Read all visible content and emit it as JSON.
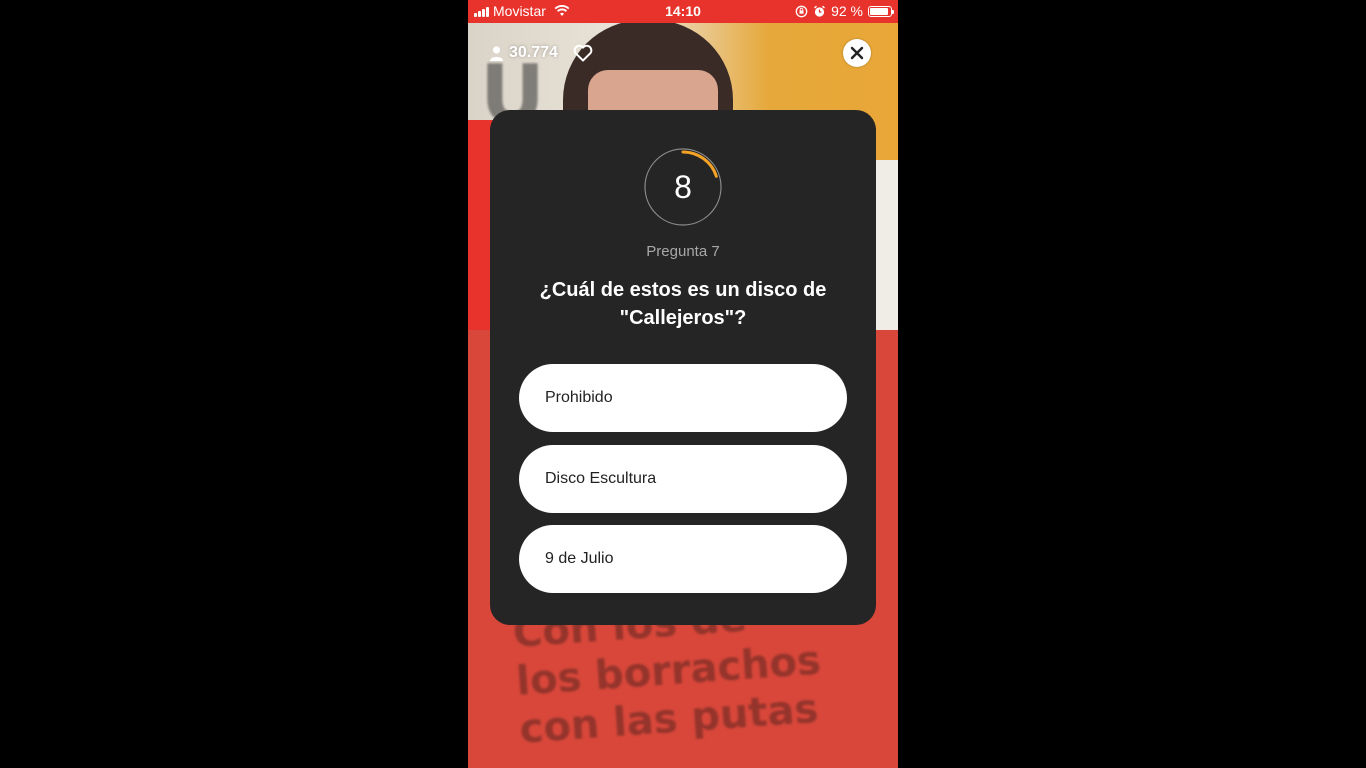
{
  "status_bar": {
    "carrier": "Movistar",
    "time": "14:10",
    "battery_percent_label": "92 %",
    "battery_level": 0.92
  },
  "overlay": {
    "viewer_count": "30.774"
  },
  "quiz": {
    "timer_value": "8",
    "timer_progress": 0.2,
    "question_label": "Pregunta 7",
    "question_text": "¿Cuál de estos es un disco de \"Callejeros\"?",
    "answers": [
      {
        "label": "Prohibido"
      },
      {
        "label": "Disco Escultura"
      },
      {
        "label": "9 de Julio"
      }
    ]
  },
  "background_text": {
    "shirt_lines": [
      "Con los de",
      "los borrachos",
      "con las putas"
    ]
  },
  "colors": {
    "status_bar": "#e8332d",
    "card": "#262525",
    "timer_arc": "#f4a326",
    "answer_bg": "#ffffff"
  }
}
